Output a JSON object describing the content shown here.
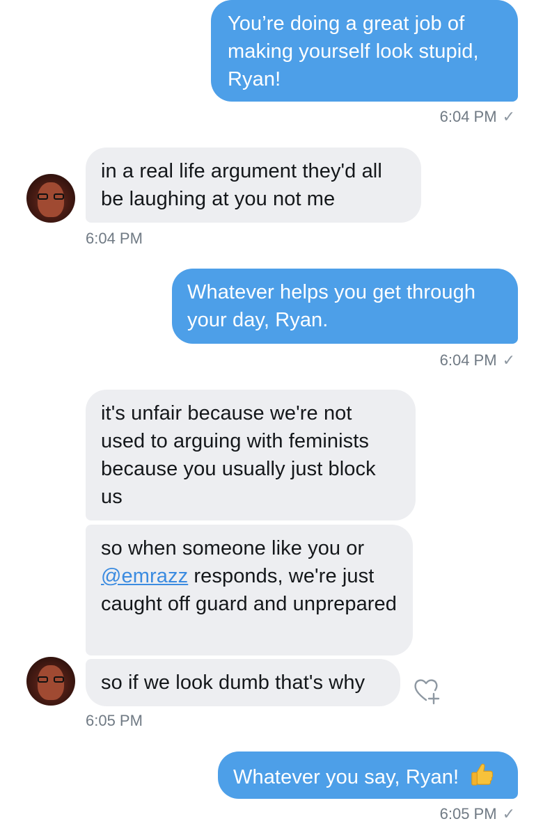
{
  "messages": {
    "m1": {
      "text": "You’re doing a great job of making yourself look stupid, Ryan!",
      "time": "6:04 PM"
    },
    "m2": {
      "text": "in a real life argument they'd all be laughing at you not me",
      "time": "6:04 PM"
    },
    "m3": {
      "text": "Whatever helps you get through your day, Ryan.",
      "time": "6:04 PM"
    },
    "m4": {
      "text": "it's unfair because we're not used to arguing with feminists because you usually just block us"
    },
    "m5": {
      "mention": "@emrazz",
      "text_after": " responds, we're just caught off guard and unprepared",
      "text_before": "so when someone like you or"
    },
    "m6": {
      "text": "so if we look dumb that's why",
      "time": "6:05 PM"
    },
    "m7": {
      "text": "Whatever you say, Ryan!",
      "time": "6:05 PM",
      "emoji": "thumbs-up"
    }
  },
  "icons": {
    "read_check": "✓",
    "react": "heart-plus-icon"
  },
  "colors": {
    "sent_bubble": "#4d9fe8",
    "received_bubble": "#edeef1",
    "timestamp": "#707a84",
    "mention": "#3b8be0"
  }
}
